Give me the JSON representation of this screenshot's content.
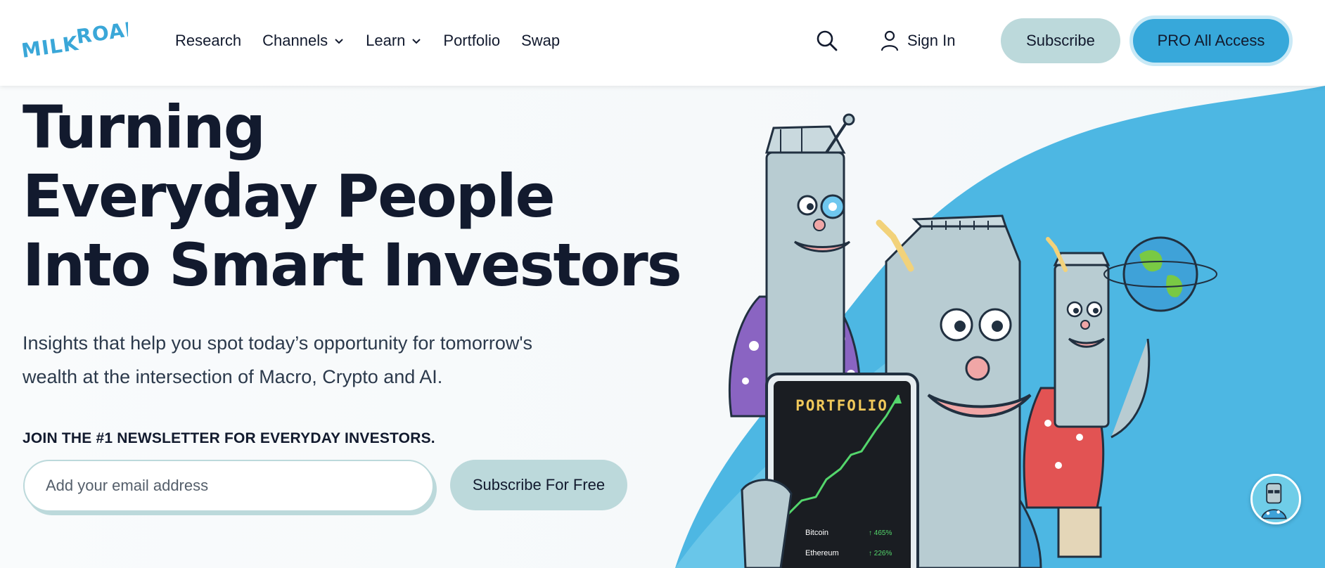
{
  "brand": {
    "logo_text": "MILK ROAD",
    "accent": "#37a8da",
    "soft_accent": "#bcd9db"
  },
  "nav": {
    "items": [
      {
        "label": "Research",
        "has_dropdown": false
      },
      {
        "label": "Channels",
        "has_dropdown": true
      },
      {
        "label": "Learn",
        "has_dropdown": true
      },
      {
        "label": "Portfolio",
        "has_dropdown": false
      },
      {
        "label": "Swap",
        "has_dropdown": false
      }
    ],
    "search_icon": "search-icon",
    "signin_label": "Sign In",
    "subscribe_label": "Subscribe",
    "pro_label": "PRO All Access"
  },
  "hero": {
    "title_lines": [
      "Turning",
      "Everyday People",
      "Into Smart Investors"
    ],
    "subtitle_line1": "Insights that help you spot today’s opportunity for tomorrow's",
    "subtitle_line2": "wealth at the intersection of Macro, Crypto and AI.",
    "join_label": "JOIN THE #1 NEWSLETTER FOR EVERYDAY INVESTORS.",
    "email_placeholder": "Add your email address",
    "email_value": "",
    "cta_label": "Subscribe For Free"
  },
  "phone": {
    "title": "PORTFOLIO",
    "rows": [
      {
        "name": "Bitcoin",
        "change": "↑ 465%"
      },
      {
        "name": "Ethereum",
        "change": "↑ 226%"
      }
    ]
  },
  "chat": {
    "icon": "chat-avatar-icon"
  }
}
